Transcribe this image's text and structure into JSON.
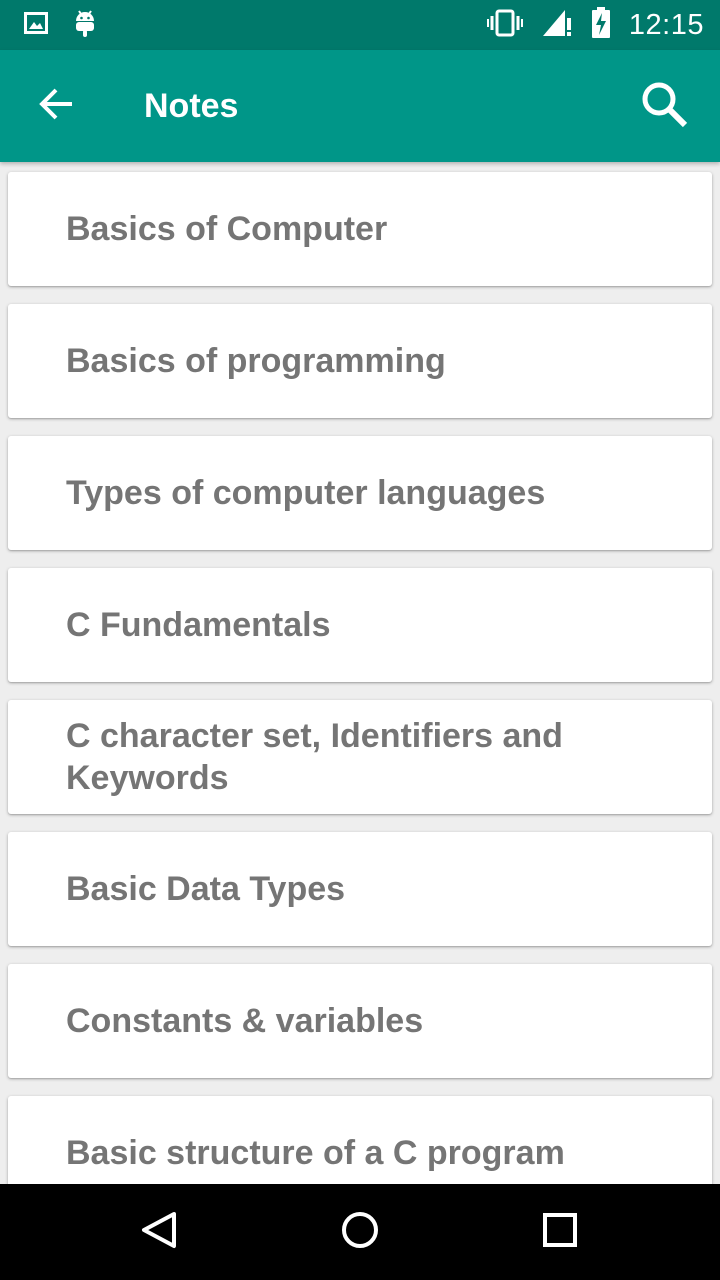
{
  "status_bar": {
    "time": "12:15",
    "icons": [
      "image-icon",
      "android-icon",
      "vibrate-icon",
      "signal-icon",
      "battery-charging-icon"
    ]
  },
  "app_bar": {
    "title": "Notes",
    "back_icon": "arrow-left-icon",
    "search_icon": "search-icon"
  },
  "notes": [
    {
      "label": "Basics of Computer"
    },
    {
      "label": "Basics of programming"
    },
    {
      "label": "Types of computer languages"
    },
    {
      "label": "C Fundamentals"
    },
    {
      "label": "C character set, Identifiers and Keywords"
    },
    {
      "label": "Basic Data Types"
    },
    {
      "label": "Constants & variables"
    },
    {
      "label": "Basic structure of a C program"
    }
  ],
  "nav_bar": {
    "buttons": [
      "back-triangle-icon",
      "home-circle-icon",
      "recents-square-icon"
    ]
  },
  "colors": {
    "status_bar": "#00796B",
    "app_bar": "#009688",
    "card_text": "#757575",
    "background": "#EEEEEE"
  }
}
